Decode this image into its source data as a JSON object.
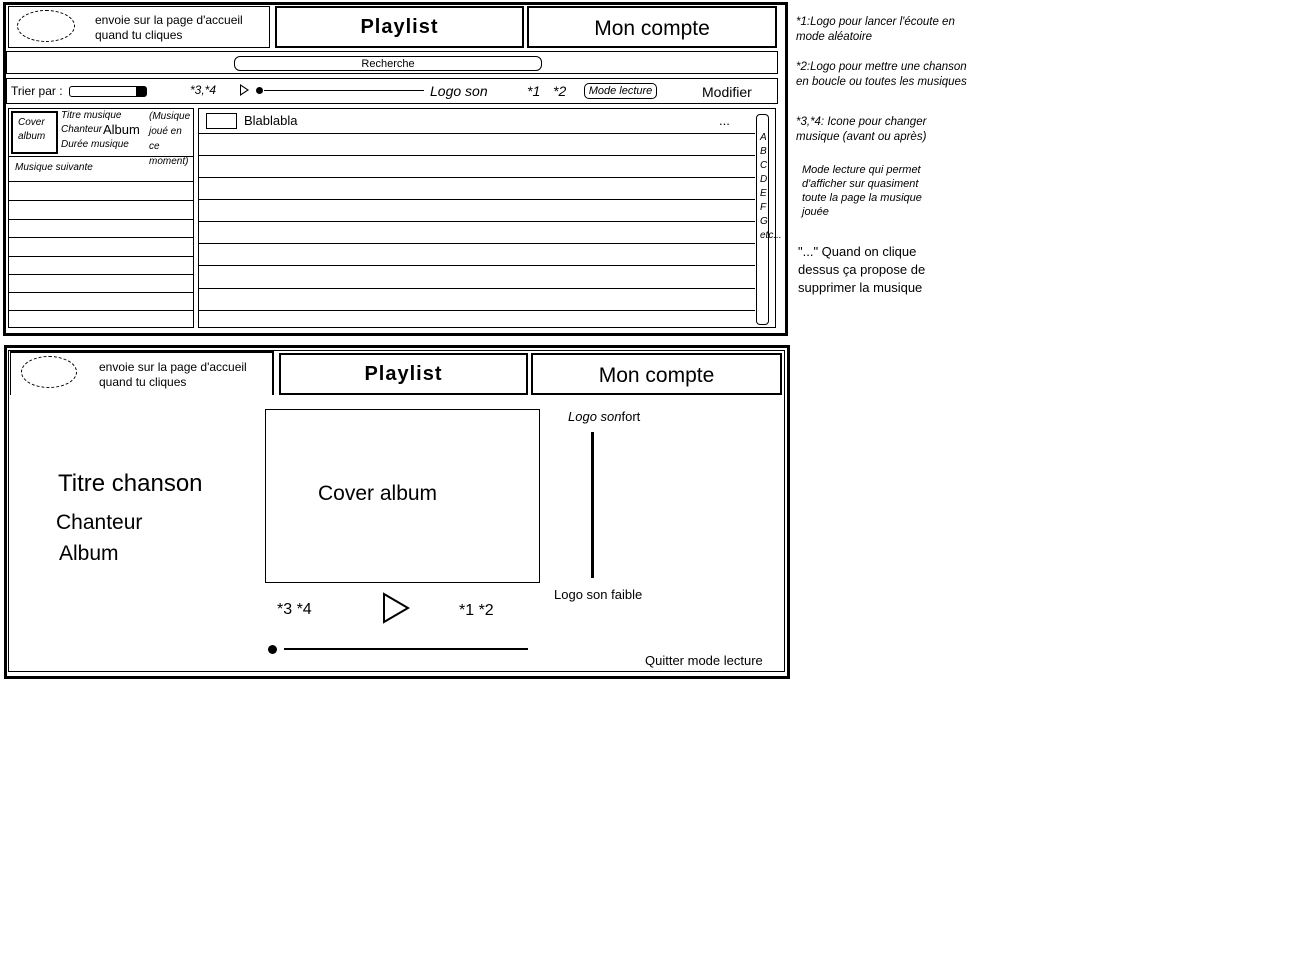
{
  "top_mockup": {
    "header": {
      "logo_caption": "envoie sur la page d'accueil quand tu cliques",
      "playlist_label": "Playlist",
      "account_label": "Mon compte"
    },
    "search": {
      "label": "Recherche"
    },
    "toolbar": {
      "sort_label": "Trier par :",
      "prev_next_label": "*3,*4",
      "sound_label": "Logo son",
      "shuffle_label": "*1",
      "loop_label": "*2",
      "mode_button": "Mode lecture",
      "edit_label": "Modifier"
    },
    "now_playing": {
      "cover_label": "Cover album",
      "title_label": "Titre musique",
      "singer_label": "Chanteur",
      "album_label": "Album",
      "duration_label": "Durée musique",
      "note": "(Musique joué en ce moment)"
    },
    "queue": {
      "title": "Musique suivante"
    },
    "playlist": {
      "first_track": "Blablabla",
      "more_label": "...",
      "alphabet": [
        "A",
        "B",
        "C",
        "D",
        "E",
        "F",
        "G",
        "etc..."
      ]
    }
  },
  "notes": {
    "n1": "*1:Logo pour lancer l'écoute en mode aléatoire",
    "n2": "*2:Logo pour mettre une chanson en boucle ou toutes les musiques",
    "n3": "*3,*4: Icone pour changer musique (avant ou après)",
    "n4": "Mode lecture qui permet d'afficher sur quasiment toute la page la musique jouée",
    "n5": "\"...\" Quand on clique dessus ça propose de supprimer la musique"
  },
  "bottom_mockup": {
    "header": {
      "logo_caption": "envoie sur la page d'accueil quand tu cliques",
      "playlist_label": "Playlist",
      "account_label": "Mon compte"
    },
    "song_title": "Titre chanson",
    "singer": "Chanteur",
    "album": "Album",
    "cover_label": "Cover album",
    "volume_high_label": "Logo son",
    "volume_high_suffix": "fort",
    "volume_low_label": "Logo son faible",
    "prev_next_label": "*3 *4",
    "shuffle_loop_label": "*1 *2",
    "quit_label": "Quitter mode lecture"
  }
}
